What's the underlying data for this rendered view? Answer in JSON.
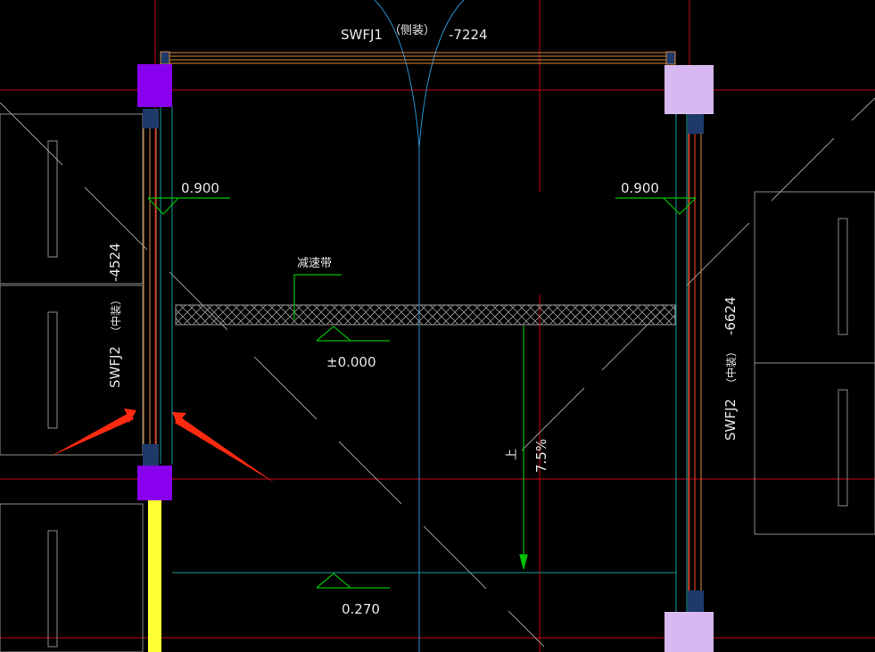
{
  "drawing": {
    "background": "#000000",
    "colors": {
      "axis_red": "#c8001e",
      "wall_white": "#8c8c8c",
      "cyan_line": "#1aa0a0",
      "green_mark": "#00c000",
      "orange_frame": "#d98a3a",
      "purple_column": "#8800ee",
      "lavender_column": "#d8b8f0",
      "yellow_wall": "#ffff33",
      "hatch": "#9a9a9a",
      "arrow_red": "#ff2a10",
      "arc_blue": "#2a8fd0"
    },
    "labels": {
      "top_code": "SWFJ1",
      "top_tag": "（侧装）",
      "top_elev": "-7224",
      "left_code": "SWFJ2",
      "left_tag": "（中装）",
      "left_elev": "-4524",
      "right_code": "SWFJ2",
      "right_tag": "（中装）",
      "right_elev": "-6624",
      "level_left": "0.900",
      "level_right": "0.900",
      "speed_bump": "减速带",
      "level_center": "±0.000",
      "level_bottom": "0.270",
      "slope_word": "上",
      "slope_value": "7.5%"
    },
    "icons": [
      "level-triangle-icon",
      "arrow-annotation-icon",
      "door-swing-arc-icon"
    ]
  }
}
